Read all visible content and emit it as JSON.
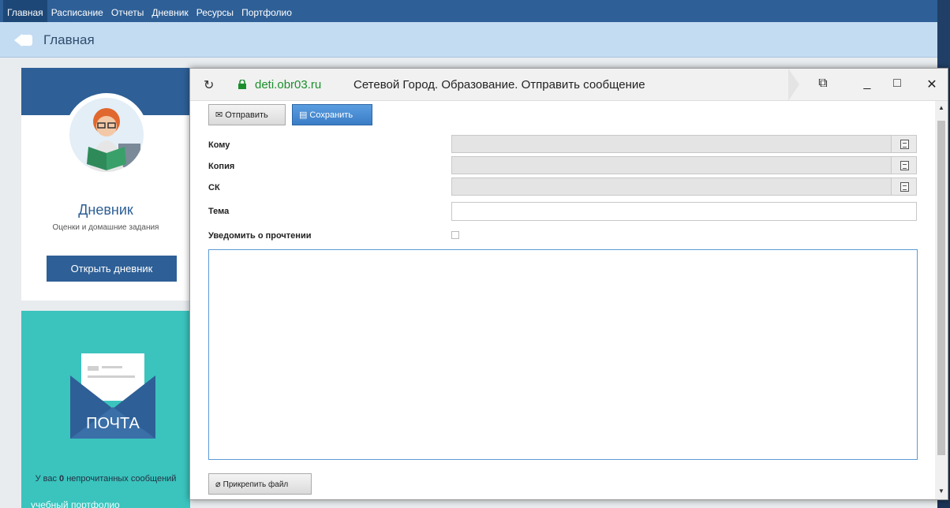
{
  "nav": {
    "items": [
      "Главная",
      "Расписание",
      "Отчеты",
      "Дневник",
      "Ресурсы",
      "Портфолио"
    ]
  },
  "header": {
    "title": "Главная"
  },
  "diary_card": {
    "title": "Дневник",
    "subtitle": "Оценки и домашние задания",
    "button": "Открыть дневник"
  },
  "mail_card": {
    "badge": "ПОЧТА",
    "unread_prefix": "У вас ",
    "unread_count": "0",
    "unread_suffix": " непрочитанных сообщений",
    "cutoff_text": "учебный портфолио"
  },
  "popup": {
    "url": "deti.obr03.ru",
    "title": "Сетевой Город. Образование. Отправить сообщение",
    "send_label": "Отправить",
    "save_label": "Сохранить",
    "to_label": "Кому",
    "cc_label": "Копия",
    "bcc_label": "СК",
    "subject_label": "Тема",
    "notify_label": "Уведомить о прочтении",
    "attach_label": "Прикрепить файл"
  },
  "colors": {
    "nav": "#2e5f96",
    "mail": "#3bc3bd",
    "url": "#1a8f2c",
    "save": "#3a7dc6"
  }
}
